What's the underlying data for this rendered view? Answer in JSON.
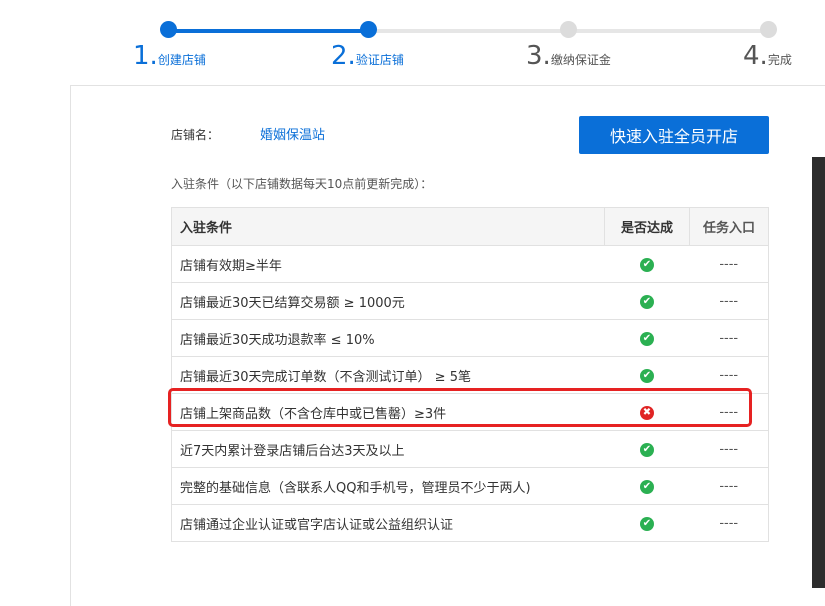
{
  "steps": [
    {
      "num": "1.",
      "label": "创建店铺",
      "state": "done"
    },
    {
      "num": "2.",
      "label": "验证店铺",
      "state": "current"
    },
    {
      "num": "3.",
      "label": "缴纳保证金",
      "state": "todo"
    },
    {
      "num": "4.",
      "label": "完成",
      "state": "todo"
    }
  ],
  "shop": {
    "label": "店铺名：",
    "name": "婚姻保温站"
  },
  "quick_button": "快速入驻全员开店",
  "conditions_intro": "入驻条件（以下店铺数据每天10点前更新完成）：",
  "table": {
    "headers": [
      "入驻条件",
      "是否达成",
      "任务入口"
    ],
    "rows": [
      {
        "condition": "店铺有效期≥半年",
        "status": "ok",
        "task": "----"
      },
      {
        "condition": "店铺最近30天已结算交易额 ≥ 1000元",
        "status": "ok",
        "task": "----"
      },
      {
        "condition": "店铺最近30天成功退款率 ≤ 10%",
        "status": "ok",
        "task": "----"
      },
      {
        "condition": "店铺最近30天完成订单数（不含测试订单） ≥ 5笔",
        "status": "ok",
        "task": "----"
      },
      {
        "condition": "店铺上架商品数（不含仓库中或已售罄）≥3件",
        "status": "fail",
        "task": "----"
      },
      {
        "condition": "近7天内累计登录店铺后台达3天及以上",
        "status": "ok",
        "task": "----"
      },
      {
        "condition": "完整的基础信息（含联系人QQ和手机号，管理员不少于两人)",
        "status": "ok",
        "task": "----"
      },
      {
        "condition": "店铺通过企业认证或官字店认证或公益组织认证",
        "status": "ok",
        "task": "----"
      }
    ]
  },
  "colors": {
    "primary": "#0a6fd8",
    "ok": "#2bb052",
    "fail": "#e02424",
    "highlight": "#e62222"
  }
}
